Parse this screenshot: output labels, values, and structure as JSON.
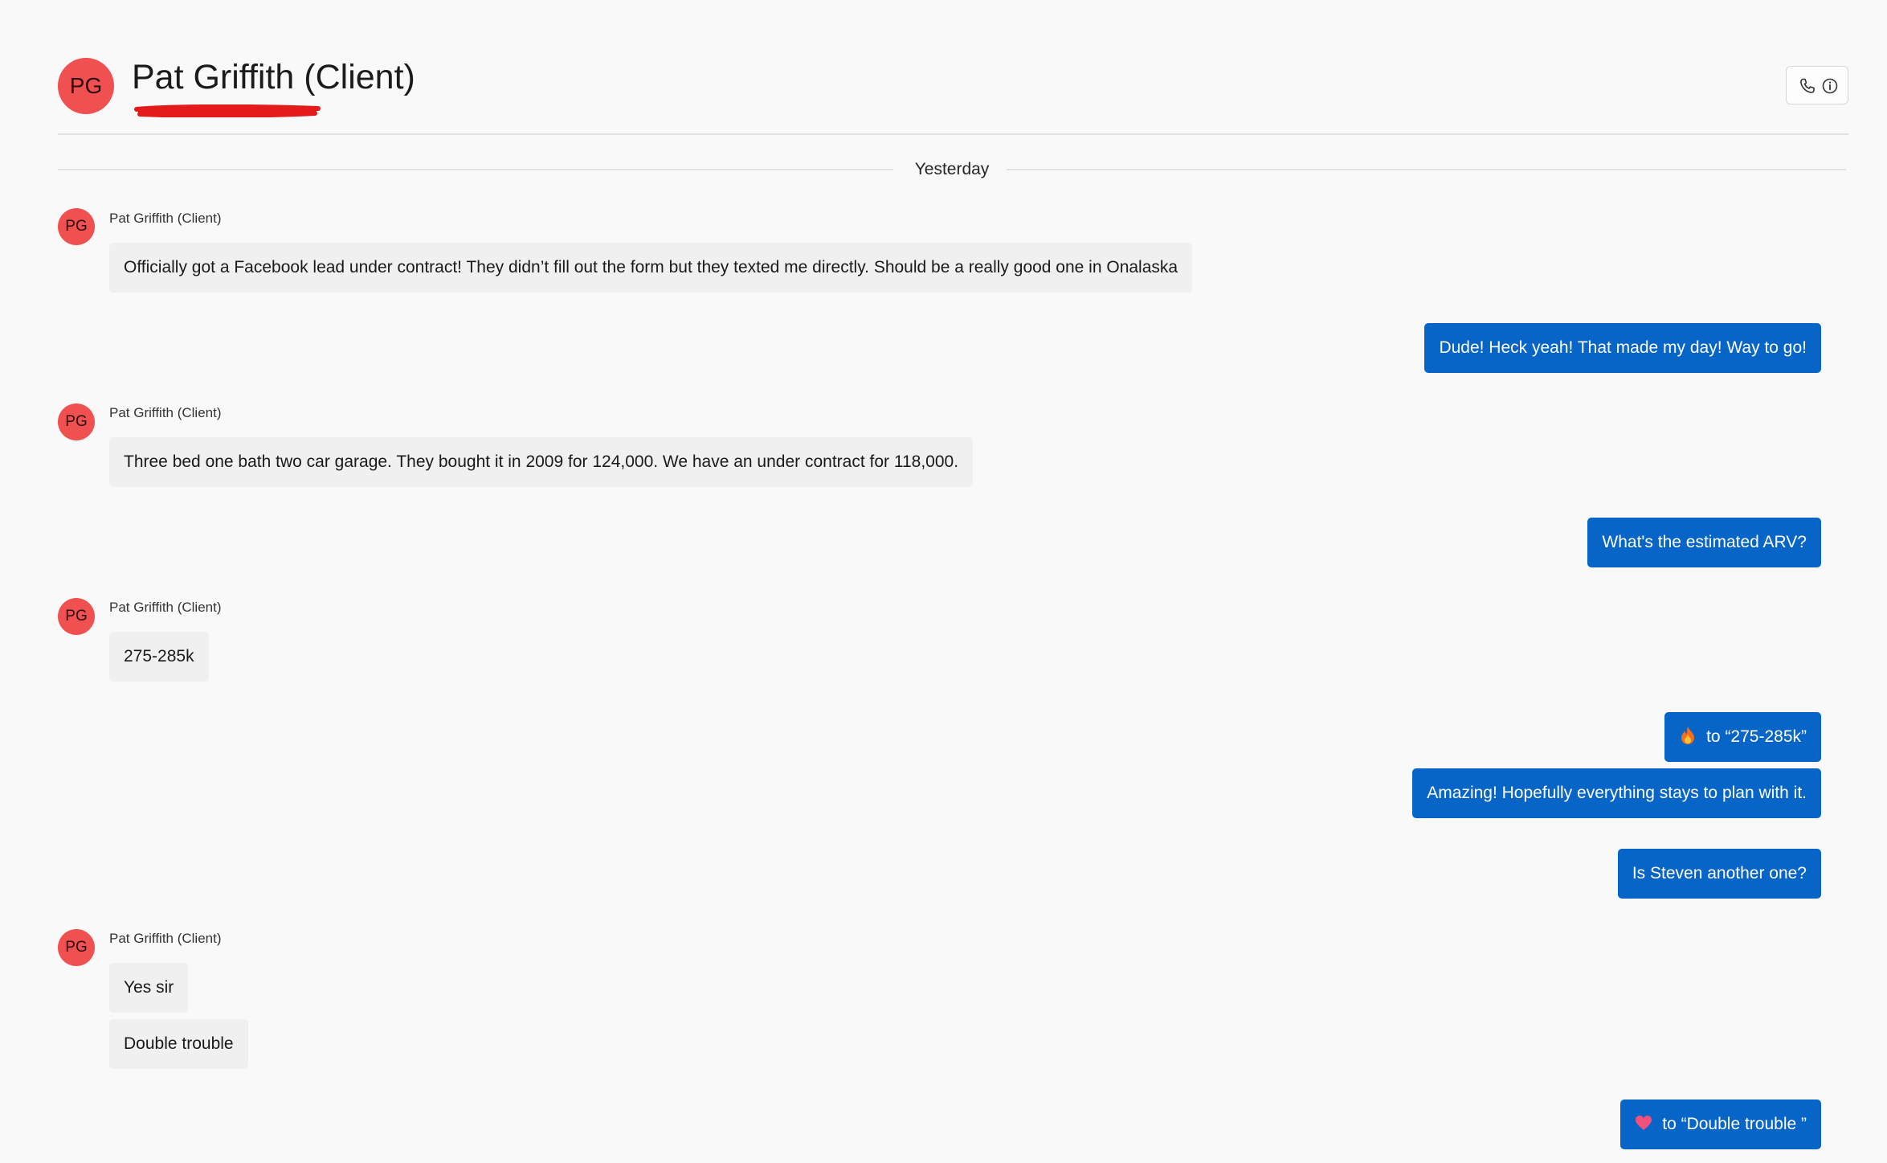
{
  "header": {
    "avatar_initials": "PG",
    "title": "Pat Griffith (Client)",
    "call_icon": "phone-icon",
    "info_icon": "info-icon"
  },
  "date_divider": "Yesterday",
  "colors": {
    "avatar": "#f05050",
    "incoming_bubble": "#f0f0f0",
    "outgoing_bubble": "#0765c7",
    "redaction": "#e31b1b"
  },
  "messages": [
    {
      "direction": "in",
      "sender": "Pat Griffith (Client)",
      "initials": "PG",
      "text": "Officially got a Facebook lead under contract! They didn’t fill out the form but they texted me directly. Should be a really good one in Onalaska"
    },
    {
      "direction": "out",
      "text": "Dude! Heck yeah! That made my day! Way to go!"
    },
    {
      "direction": "in",
      "sender": "Pat Griffith (Client)",
      "initials": "PG",
      "text": "Three bed one bath two car garage. They bought it in 2009 for 124,000. We have an under contract for 118,000."
    },
    {
      "direction": "out",
      "text": "What's the estimated ARV?"
    },
    {
      "direction": "in",
      "sender": "Pat Griffith (Client)",
      "initials": "PG",
      "text": "275-285k"
    },
    {
      "direction": "out",
      "reaction_icon": "fire-icon",
      "text": "to “275-285k”"
    },
    {
      "direction": "out",
      "text": "Amazing! Hopefully everything stays to plan with it."
    },
    {
      "direction": "out",
      "text": "Is Steven another one?"
    },
    {
      "direction": "in",
      "sender": "Pat Griffith (Client)",
      "initials": "PG",
      "text": "Yes sir"
    },
    {
      "direction": "in",
      "text": "Double trouble"
    },
    {
      "direction": "out",
      "reaction_icon": "heart-icon",
      "text": "to “Double trouble ”"
    }
  ]
}
